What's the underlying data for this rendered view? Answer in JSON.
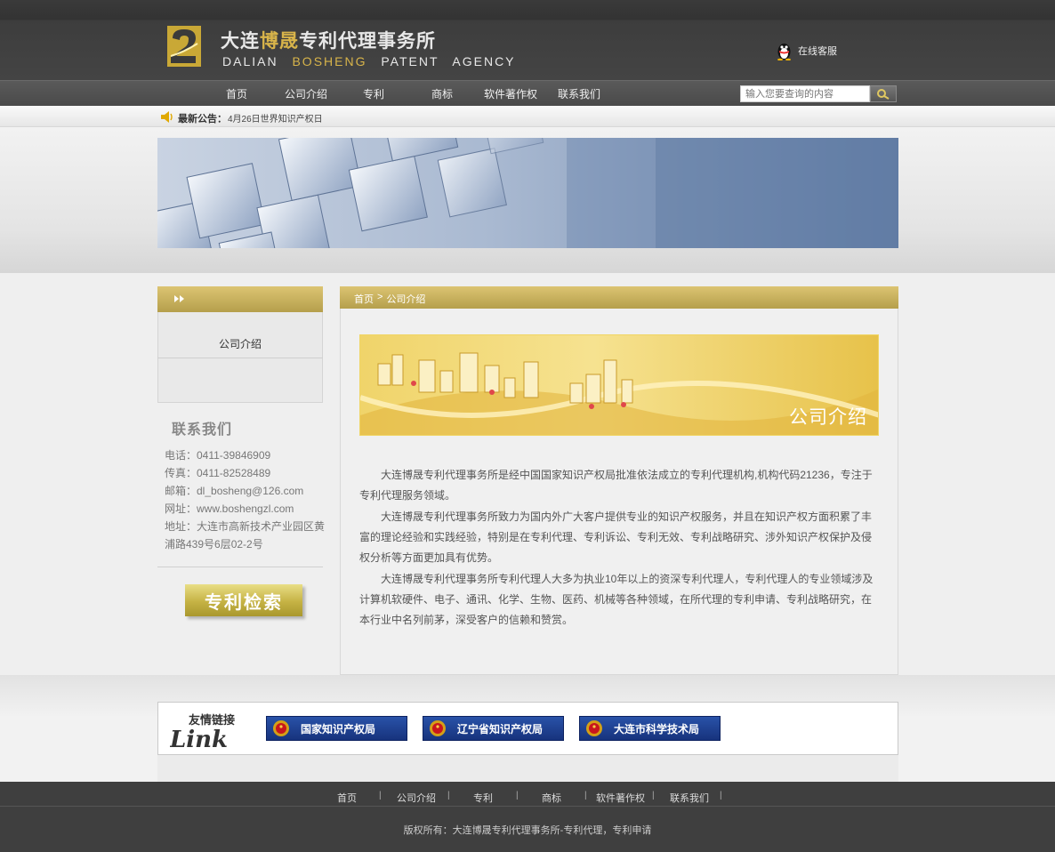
{
  "header": {
    "brand_cn_1": "大连",
    "brand_cn_hl": "博晟",
    "brand_cn_2": "专利代理事务所",
    "brand_en_1": "DALIAN",
    "brand_en_hl": "BOSHENG",
    "brand_en_2": "PATENT AGENCY",
    "online_service": "在线客服"
  },
  "nav": {
    "items": [
      "首页",
      "公司介绍",
      "专利",
      "商标",
      "软件著作权",
      "联系我们"
    ],
    "search_placeholder": "输入您要查询的内容"
  },
  "notice": {
    "label": "最新公告：",
    "text": "4月26日世界知识产权日"
  },
  "sidebar": {
    "menu_item": "公司介绍",
    "contact_title": "联系我们",
    "contact": [
      "电话：0411-39846909",
      "传真：0411-82528489",
      "邮箱：dl_bosheng@126.com",
      "网址：www.boshengzl.com",
      "地址：大连市高新技术产业园区黄",
      "浦路439号6层02-2号"
    ],
    "patent_search": "专利检索"
  },
  "content": {
    "breadcrumb_home": "首页",
    "breadcrumb_sep": ">",
    "breadcrumb_current": "公司介绍",
    "banner_title": "公司介绍",
    "paragraphs": [
      "大连博晟专利代理事务所是经中国国家知识产权局批准依法成立的专利代理机构,机构代码21236，专注于专利代理服务领域。",
      "大连博晟专利代理事务所致力为国内外广大客户提供专业的知识产权服务，并且在知识产权方面积累了丰富的理论经验和实践经验，特别是在专利代理、专利诉讼、专利无效、专利战略研究、涉外知识产权保护及侵权分析等方面更加具有优势。",
      "大连博晟专利代理事务所专利代理人大多为执业10年以上的资深专利代理人，专利代理人的专业领域涉及计算机软硬件、电子、通讯、化学、生物、医药、机械等各种领域，在所代理的专利申请、专利战略研究，在本行业中名列前茅，深受客户的信赖和赞赏。"
    ]
  },
  "links": {
    "title": "友情链接",
    "logo_text": "Link",
    "items": [
      "国家知识产权局",
      "辽宁省知识产权局",
      "大连市科学技术局"
    ]
  },
  "footer": {
    "items": [
      "首页",
      "公司介绍",
      "专利",
      "商标",
      "软件著作权",
      "联系我们"
    ],
    "separator": "|",
    "copyright": "版权所有：大连博晟专利代理事务所-专利代理，专利申请"
  },
  "colors": {
    "gold": "#c6b05c",
    "dark": "#3f3f3f",
    "link_blue": "#1f4493"
  }
}
